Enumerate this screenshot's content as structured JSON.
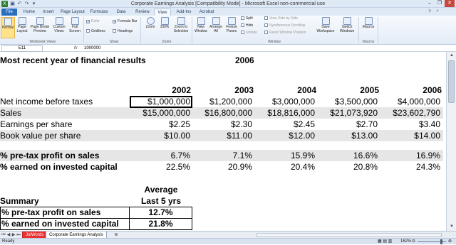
{
  "window": {
    "title": "Corporate Earnings Analysis  [Compatibility Mode]  -  Microsoft Excel non-commercial use"
  },
  "ribbon": {
    "tabs": [
      "File",
      "Home",
      "Insert",
      "Page Layout",
      "Formulas",
      "Data",
      "Review",
      "View",
      "Add-Ins",
      "Acrobat"
    ],
    "active_tab": "View",
    "workbook_views": {
      "group_label": "Workbook Views",
      "normal": "Normal",
      "page_layout": "Page Layout",
      "page_break_preview": "Page Break Preview",
      "custom_views": "Custom Views",
      "full_screen": "Full Screen"
    },
    "show": {
      "group_label": "Show",
      "ruler": "Ruler",
      "formula_bar": "Formula Bar",
      "gridlines": "Gridlines",
      "headings": "Headings"
    },
    "zoom": {
      "group_label": "Zoom",
      "zoom": "Zoom",
      "hundred": "100%",
      "zoom_to_selection": "Zoom to Selection"
    },
    "window": {
      "group_label": "Window",
      "new_window": "New Window",
      "arrange_all": "Arrange All",
      "freeze_panes": "Freeze Panes",
      "split": "Split",
      "hide": "Hide",
      "unhide": "Unhide",
      "view_side_by_side": "View Side by Side",
      "synchronous_scrolling": "Synchronous Scrolling",
      "reset_window_position": "Reset Window Position",
      "save_workspace": "Save Workspace",
      "switch_windows": "Switch Windows"
    },
    "macros": {
      "group_label": "Macros",
      "macros": "Macros"
    }
  },
  "formula_bar": {
    "name_box": "E11",
    "fx": "fx",
    "value": "1000000"
  },
  "sheet": {
    "header_label": "Most recent year of financial results",
    "header_year": "2006",
    "years": [
      "2002",
      "2003",
      "2004",
      "2005",
      "2006"
    ],
    "rows": [
      {
        "label": "Net income before taxes",
        "values": [
          "$1,000,000",
          "$1,200,000",
          "$3,000,000",
          "$3,500,000",
          "$4,000,000"
        ]
      },
      {
        "label": "Sales",
        "values": [
          "$15,000,000",
          "$16,800,000",
          "$18,816,000",
          "$21,073,920",
          "$23,602,790"
        ]
      },
      {
        "label": "Earnings per share",
        "values": [
          "$2.25",
          "$2.30",
          "$2.45",
          "$2.70",
          "$3.40"
        ]
      },
      {
        "label": "Book value per share",
        "values": [
          "$10.00",
          "$11.00",
          "$12.00",
          "$13.00",
          "$14.00"
        ]
      }
    ],
    "ratio_rows": [
      {
        "label": "% pre-tax profit on sales",
        "values": [
          "6.7%",
          "7.1%",
          "15.9%",
          "16.6%",
          "16.9%"
        ]
      },
      {
        "label": "% earned on invested capital",
        "values": [
          "22.5%",
          "20.9%",
          "20.4%",
          "20.8%",
          "24.3%"
        ]
      }
    ],
    "summary": {
      "label": "Summary",
      "avg_head_1": "Average",
      "avg_head_2": "Last 5 yrs",
      "rows": [
        {
          "label": "% pre-tax profit on sales",
          "value": "12.7%"
        },
        {
          "label": "% earned on invested capital",
          "value": "21.8%"
        }
      ]
    }
  },
  "sheet_tabs": [
    "JotWords",
    "Corporate Earnings Analysis"
  ],
  "status": {
    "ready": "Ready",
    "zoom": "162%"
  },
  "colors": {
    "band": "#e6e6e6",
    "file_tab": "#2a6fbd",
    "red_tab": "#e83030"
  }
}
